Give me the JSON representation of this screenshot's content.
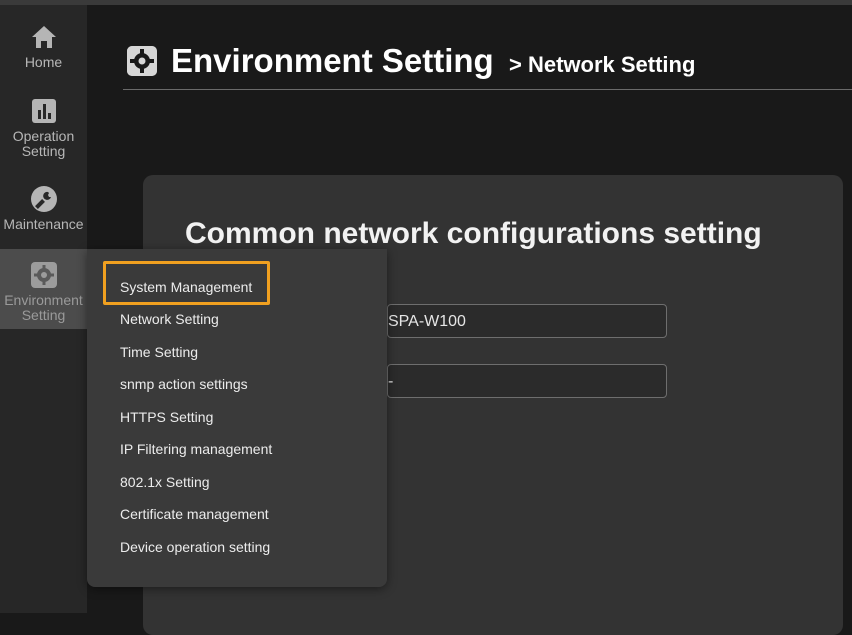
{
  "sidebar": {
    "items": [
      {
        "label": "Home",
        "icon": "home-icon"
      },
      {
        "label": "Operation\nSetting",
        "icon": "chart-icon"
      },
      {
        "label": "Maintenance",
        "icon": "wrench-icon"
      },
      {
        "label": "Environment\nSetting",
        "icon": "gear-icon"
      }
    ]
  },
  "header": {
    "title": "Environment Setting",
    "subtitle": "> Network Setting",
    "icon": "gear-icon"
  },
  "panel": {
    "title": "Common network configurations setting",
    "fields": [
      {
        "value": "SPA-W100"
      },
      {
        "value": "-"
      }
    ]
  },
  "menu": {
    "items": [
      "System Management",
      "Network Setting",
      "Time Setting",
      "snmp action settings",
      "HTTPS Setting",
      "IP Filtering management",
      "802.1x Setting",
      "Certificate management",
      "Device operation setting"
    ],
    "highlighted_item": "System Management",
    "highlight_color": "#f0a020"
  }
}
